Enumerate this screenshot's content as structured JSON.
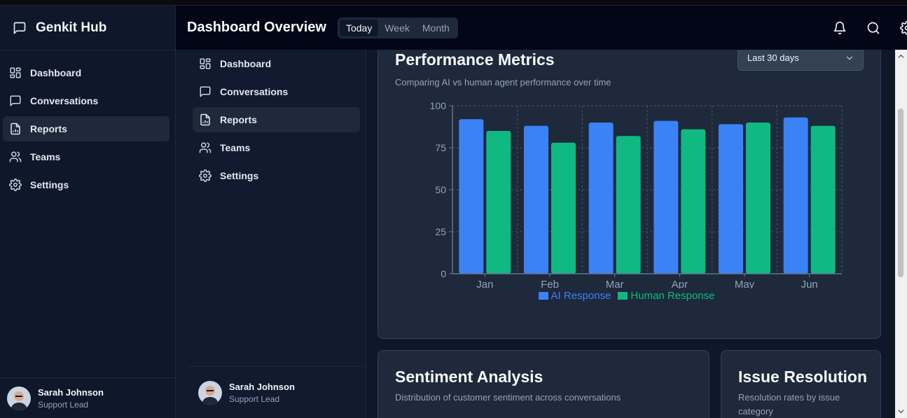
{
  "app": {
    "name": "Genkit Hub"
  },
  "sidebar": {
    "items": [
      {
        "label": "Dashboard",
        "icon": "dashboard-grid-icon"
      },
      {
        "label": "Conversations",
        "icon": "message-icon"
      },
      {
        "label": "Reports",
        "icon": "report-file-icon",
        "active": true
      },
      {
        "label": "Teams",
        "icon": "users-icon"
      },
      {
        "label": "Settings",
        "icon": "gear-icon"
      }
    ],
    "user": {
      "name": "Sarah Johnson",
      "role": "Support Lead"
    }
  },
  "header": {
    "title": "Dashboard Overview",
    "ranges": [
      "Today",
      "Week",
      "Month"
    ],
    "active_range": "Today",
    "icons": [
      "bell-icon",
      "search-icon",
      "gear-icon"
    ]
  },
  "performance": {
    "title": "Performance Metrics",
    "subtitle": "Comparing AI vs human agent performance over time",
    "period": "Last 30 days"
  },
  "chart_data": {
    "type": "bar",
    "categories": [
      "Jan",
      "Feb",
      "Mar",
      "Apr",
      "May",
      "Jun"
    ],
    "series": [
      {
        "name": "AI Response",
        "color": "#3b82f6",
        "values": [
          92,
          88,
          90,
          91,
          89,
          93
        ]
      },
      {
        "name": "Human Response",
        "color": "#10b981",
        "values": [
          85,
          78,
          82,
          86,
          90,
          88
        ]
      }
    ],
    "ylim": [
      0,
      100
    ],
    "yticks": [
      0,
      25,
      50,
      75,
      100
    ],
    "grid": true,
    "legend": "bottom"
  },
  "sentiment": {
    "title": "Sentiment Analysis",
    "subtitle": "Distribution of customer sentiment across conversations"
  },
  "issues": {
    "title": "Issue Resolution",
    "subtitle": "Resolution rates by issue category"
  },
  "colors": {
    "accent": "#3b82f6",
    "success": "#10b981",
    "background": "#0f172a",
    "card": "#1e293b"
  }
}
